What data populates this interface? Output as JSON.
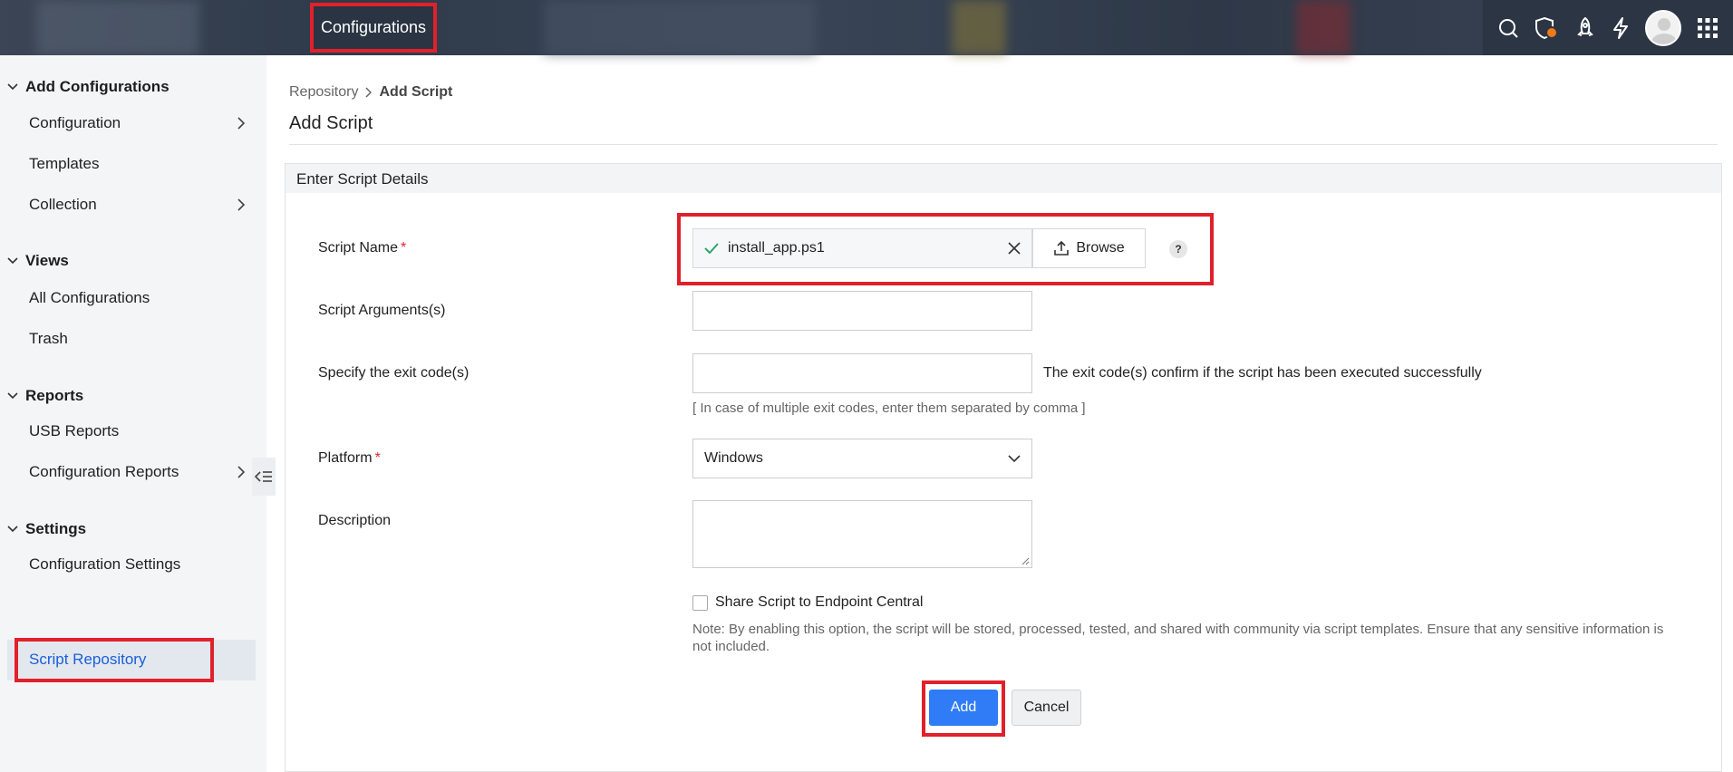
{
  "topbar": {
    "module_tab": "Configurations",
    "icons": [
      "search-icon",
      "shield-alert-icon",
      "rocket-icon",
      "lightning-icon",
      "avatar",
      "app-grid-icon"
    ],
    "accent": "#e0212b"
  },
  "sidebar": {
    "sections": [
      {
        "title": "Add Configurations",
        "items": [
          {
            "label": "Configuration",
            "has_submenu": true
          },
          {
            "label": "Templates",
            "has_submenu": false
          },
          {
            "label": "Collection",
            "has_submenu": true
          }
        ]
      },
      {
        "title": "Views",
        "items": [
          {
            "label": "All Configurations",
            "has_submenu": false
          },
          {
            "label": "Trash",
            "has_submenu": false
          }
        ]
      },
      {
        "title": "Reports",
        "items": [
          {
            "label": "USB Reports",
            "has_submenu": false
          },
          {
            "label": "Configuration Reports",
            "has_submenu": true
          }
        ]
      },
      {
        "title": "Settings",
        "items": [
          {
            "label": "Configuration Settings",
            "has_submenu": false
          },
          {
            "label": "Script Repository",
            "has_submenu": false,
            "active": true
          }
        ]
      }
    ]
  },
  "breadcrumb": {
    "parent": "Repository",
    "current": "Add Script"
  },
  "page_title": "Add Script",
  "form": {
    "section_title": "Enter Script Details",
    "script_name": {
      "label": "Script Name",
      "required_mark": "*",
      "value": "install_app.ps1",
      "browse_label": "Browse",
      "help_label": "?"
    },
    "script_arguments": {
      "label": "Script Arguments(s)",
      "value": ""
    },
    "exit_codes": {
      "label": "Specify the exit code(s)",
      "value": "",
      "hint": "The exit code(s) confirm if the script has been executed successfully",
      "subhint": "[ In case of multiple exit codes, enter them separated by comma ]"
    },
    "platform": {
      "label": "Platform",
      "required_mark": "*",
      "value": "Windows"
    },
    "description": {
      "label": "Description",
      "value": ""
    },
    "share": {
      "label": "Share Script to Endpoint Central",
      "checked": false,
      "note": "Note: By enabling this option, the script will be stored, processed, tested, and shared with community via script templates. Ensure that any sensitive information is not included."
    },
    "add_label": "Add",
    "cancel_label": "Cancel"
  },
  "colors": {
    "primary": "#2f7cf6",
    "active_link": "#1b5fd6",
    "highlight": "#e0212b",
    "success": "#2fa56a"
  }
}
